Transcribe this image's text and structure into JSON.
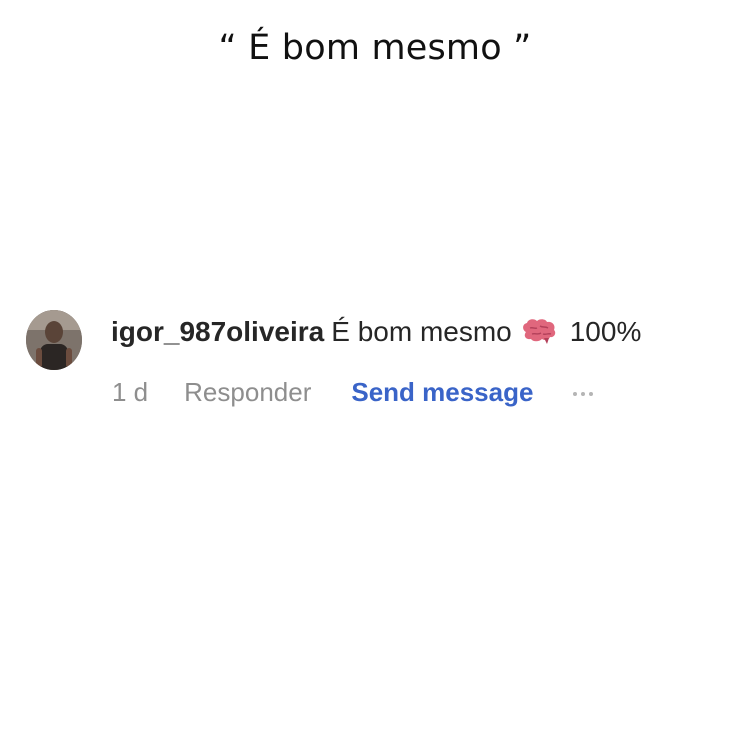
{
  "caption": "“ É bom mesmo ”",
  "comment": {
    "username": "igor_987oliveira",
    "text": "É bom mesmo",
    "emoji_icon": "brain-icon",
    "percent": "100%",
    "time": "1 d",
    "reply_label": "Responder",
    "send_message_label": "Send message",
    "more_icon": "ellipsis-icon"
  },
  "colors": {
    "link_blue": "#3a64c8",
    "muted_gray": "#8e8e8e",
    "brain_pink": "#e0677d"
  }
}
